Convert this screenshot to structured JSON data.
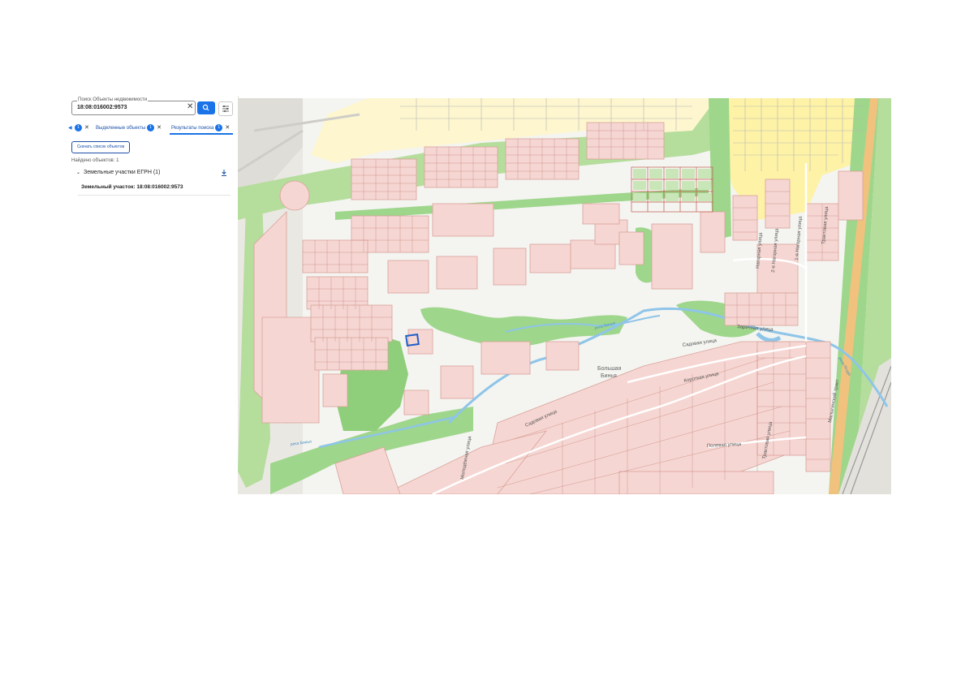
{
  "search": {
    "label": "Поиск Объекты недвижимости",
    "value": "18:08:016002:9573"
  },
  "tabs": [
    {
      "label": "Выделенные объекты",
      "count": "1"
    },
    {
      "label": "Результаты поиска",
      "count": "1"
    }
  ],
  "tabs_first_count": "1",
  "download_list_label": "Скачать список объектов",
  "found_count_text": "Найдено объектов: 1",
  "result_group": {
    "label": "Земельные участки ЕГРН (1)"
  },
  "result_item": {
    "label": "Земельный участок: 18:08:016002:9573"
  },
  "map": {
    "labels": {
      "town": [
        "Большая",
        "Бинья"
      ],
      "streets": [
        "Садовая улица",
        "Короткая улица",
        "Полевая улица",
        "Садовая улица",
        "Заречная улица",
        "Трактовая улица",
        "Трактовая улица",
        "Молодёжная улица",
        "Малыгинский тракт",
        "Нагорная улица",
        "2-я Нагорная улица",
        "1-я Нагорная улица"
      ],
      "rivers": [
        "река Бинья",
        "река Ягода",
        "река Бинья"
      ]
    },
    "colors": {
      "parcel_fill": "#f6d6d2",
      "parcel_stroke": "#d9a29a",
      "green": "#9ed68b",
      "forest": "#b5dd9c",
      "water": "#8ec5e8",
      "road": "#f1c27d",
      "highlight": "#1f5fc9",
      "yellow_zone": "#fdf2a6"
    }
  }
}
